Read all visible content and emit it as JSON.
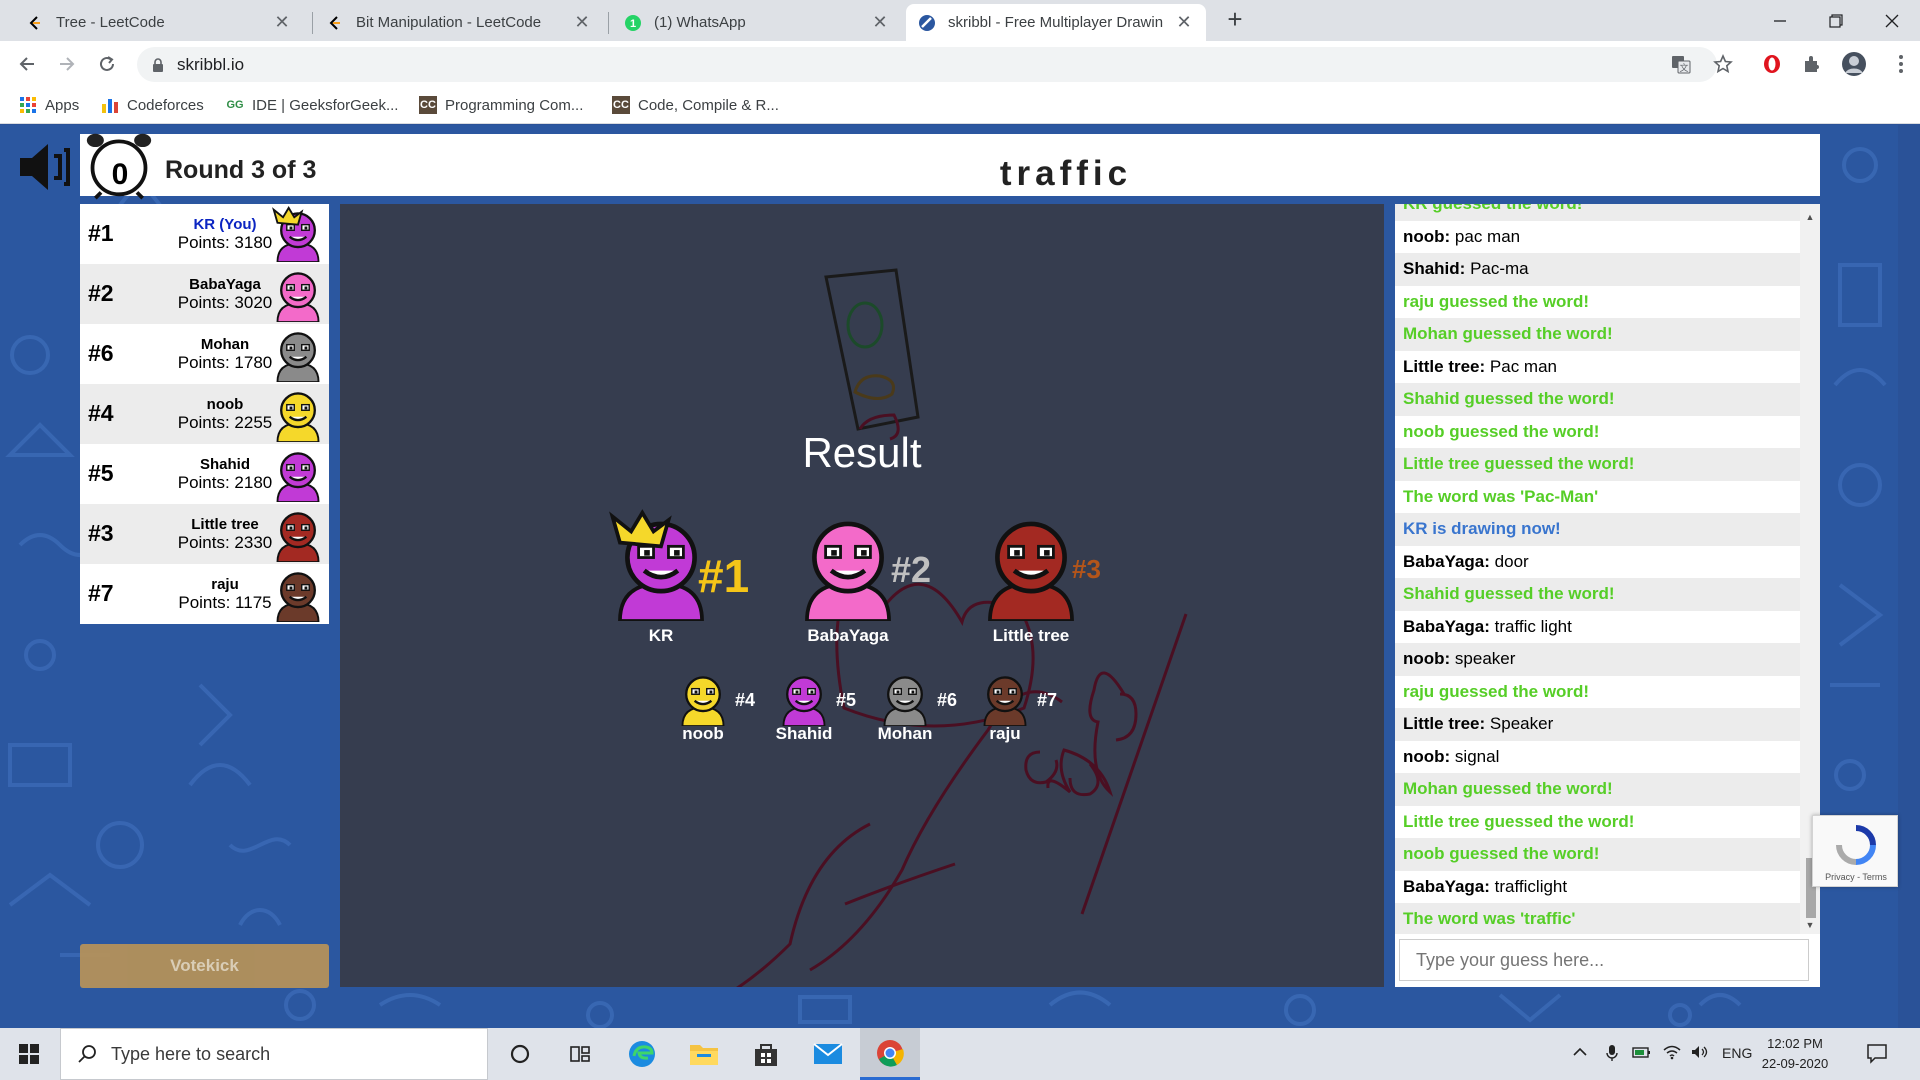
{
  "browser": {
    "tabs": [
      {
        "title": "Tree - LeetCode",
        "close": "✕"
      },
      {
        "title": "Bit Manipulation - LeetCode",
        "close": "✕"
      },
      {
        "title": "(1) WhatsApp",
        "close": "✕"
      },
      {
        "title": "skribbl - Free Multiplayer Drawin",
        "close": "✕"
      }
    ],
    "new_tab": "+",
    "url": "skribbl.io",
    "bookmarks": [
      {
        "label": "Apps"
      },
      {
        "label": "Codeforces"
      },
      {
        "label": "IDE | GeeksforGeek..."
      },
      {
        "label": "Programming Com..."
      },
      {
        "label": "Code, Compile & R..."
      }
    ]
  },
  "game": {
    "timer": "0",
    "round": "Round 3 of 3",
    "word": "traffic",
    "players": [
      {
        "rank": "#1",
        "name": "KR (You)",
        "points": "Points: 3180",
        "you": true,
        "color": "#c13ad6"
      },
      {
        "rank": "#2",
        "name": "BabaYaga",
        "points": "Points: 3020",
        "you": false,
        "color": "#f36ac9"
      },
      {
        "rank": "#6",
        "name": "Mohan",
        "points": "Points: 1780",
        "you": false,
        "color": "#8a8a8a"
      },
      {
        "rank": "#4",
        "name": "noob",
        "points": "Points: 2255",
        "you": false,
        "color": "#f5d82a"
      },
      {
        "rank": "#5",
        "name": "Shahid",
        "points": "Points: 2180",
        "you": false,
        "color": "#c13ad6"
      },
      {
        "rank": "#3",
        "name": "Little tree",
        "points": "Points: 2330",
        "you": false,
        "color": "#a32922"
      },
      {
        "rank": "#7",
        "name": "raju",
        "points": "Points: 1175",
        "you": false,
        "color": "#6b3a2a"
      }
    ],
    "votekick": "Votekick",
    "result": {
      "title": "Result",
      "podium": [
        {
          "name": "KR",
          "rank": "#1",
          "color": "#c13ad6",
          "rank_color": "#f5c518"
        },
        {
          "name": "BabaYaga",
          "rank": "#2",
          "color": "#f36ac9",
          "rank_color": "#c0c0c0"
        },
        {
          "name": "Little tree",
          "rank": "#3",
          "color": "#a32922",
          "rank_color": "#b4551a"
        }
      ],
      "others": [
        {
          "name": "noob",
          "rank": "#4",
          "color": "#f5d82a"
        },
        {
          "name": "Shahid",
          "rank": "#5",
          "color": "#c13ad6"
        },
        {
          "name": "Mohan",
          "rank": "#6",
          "color": "#8a8a8a"
        },
        {
          "name": "raju",
          "rank": "#7",
          "color": "#6b3a2a"
        }
      ]
    },
    "chat": [
      {
        "type": "green",
        "text": "KR guessed the word!"
      },
      {
        "type": "msg",
        "user": "noob:",
        "text": " pac man"
      },
      {
        "type": "msg",
        "user": "Shahid:",
        "text": " Pac-ma"
      },
      {
        "type": "green",
        "text": "raju guessed the word!"
      },
      {
        "type": "green",
        "text": "Mohan guessed the word!"
      },
      {
        "type": "msg",
        "user": "Little tree:",
        "text": " Pac man"
      },
      {
        "type": "green",
        "text": "Shahid guessed the word!"
      },
      {
        "type": "green",
        "text": "noob guessed the word!"
      },
      {
        "type": "green",
        "text": "Little tree guessed the word!"
      },
      {
        "type": "green",
        "text": "The word was 'Pac-Man'"
      },
      {
        "type": "blue",
        "text": "KR is drawing now!"
      },
      {
        "type": "msg",
        "user": "BabaYaga:",
        "text": " door"
      },
      {
        "type": "green",
        "text": "Shahid guessed the word!"
      },
      {
        "type": "msg",
        "user": "BabaYaga:",
        "text": " traffic light"
      },
      {
        "type": "msg",
        "user": "noob:",
        "text": " speaker"
      },
      {
        "type": "green",
        "text": "raju guessed the word!"
      },
      {
        "type": "msg",
        "user": "Little tree:",
        "text": " Speaker"
      },
      {
        "type": "msg",
        "user": "noob:",
        "text": " signal"
      },
      {
        "type": "green",
        "text": "Mohan guessed the word!"
      },
      {
        "type": "green",
        "text": "Little tree guessed the word!"
      },
      {
        "type": "green",
        "text": "noob guessed the word!"
      },
      {
        "type": "msg",
        "user": "BabaYaga:",
        "text": " trafficlight"
      },
      {
        "type": "green",
        "text": "The word was 'traffic'"
      }
    ],
    "guess_placeholder": "Type your guess here...",
    "recaptcha_text": "Privacy - Terms"
  },
  "taskbar": {
    "search_placeholder": "Type here to search",
    "lang": "ENG",
    "time": "12:02 PM",
    "date": "22-09-2020"
  },
  "colors": {
    "page_bg": "#2b57a0",
    "canvas_bg": "#363d4f",
    "chat_green": "#56ce27",
    "chat_blue": "#3975ce",
    "you_blue": "#0b25c2"
  }
}
